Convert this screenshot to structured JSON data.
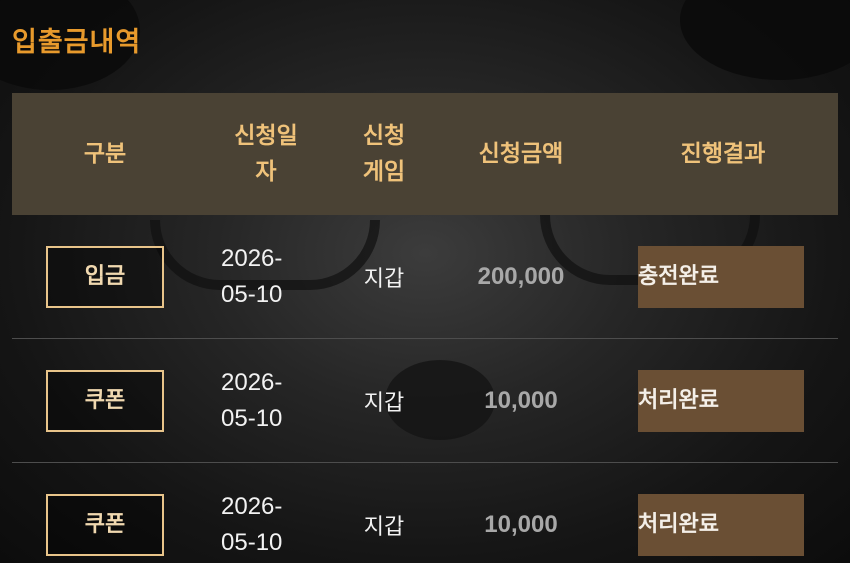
{
  "page": {
    "title": "입출금내역"
  },
  "table": {
    "headers": {
      "type": "구분",
      "date": "신청일자",
      "game": "신청게임",
      "amount": "신청금액",
      "result": "진행결과"
    },
    "rows": [
      {
        "type": "입금",
        "date_line1": "2026-",
        "date_line2": "05-10",
        "game": "지갑",
        "amount": "200,000",
        "result": "충전완료"
      },
      {
        "type": "쿠폰",
        "date_line1": "2026-",
        "date_line2": "05-10",
        "game": "지갑",
        "amount": "10,000",
        "result": "처리완료"
      },
      {
        "type": "쿠폰",
        "date_line1": "2026-",
        "date_line2": "05-10",
        "game": "지갑",
        "amount": "10,000",
        "result": "처리완료"
      }
    ]
  },
  "colors": {
    "title": "#e89a2c",
    "header_bg": "#4a4234",
    "header_text": "#efc27a",
    "type_border": "#e8c48a",
    "status_bg": "#6a4f34",
    "amount_text": "#a8a8a8"
  }
}
